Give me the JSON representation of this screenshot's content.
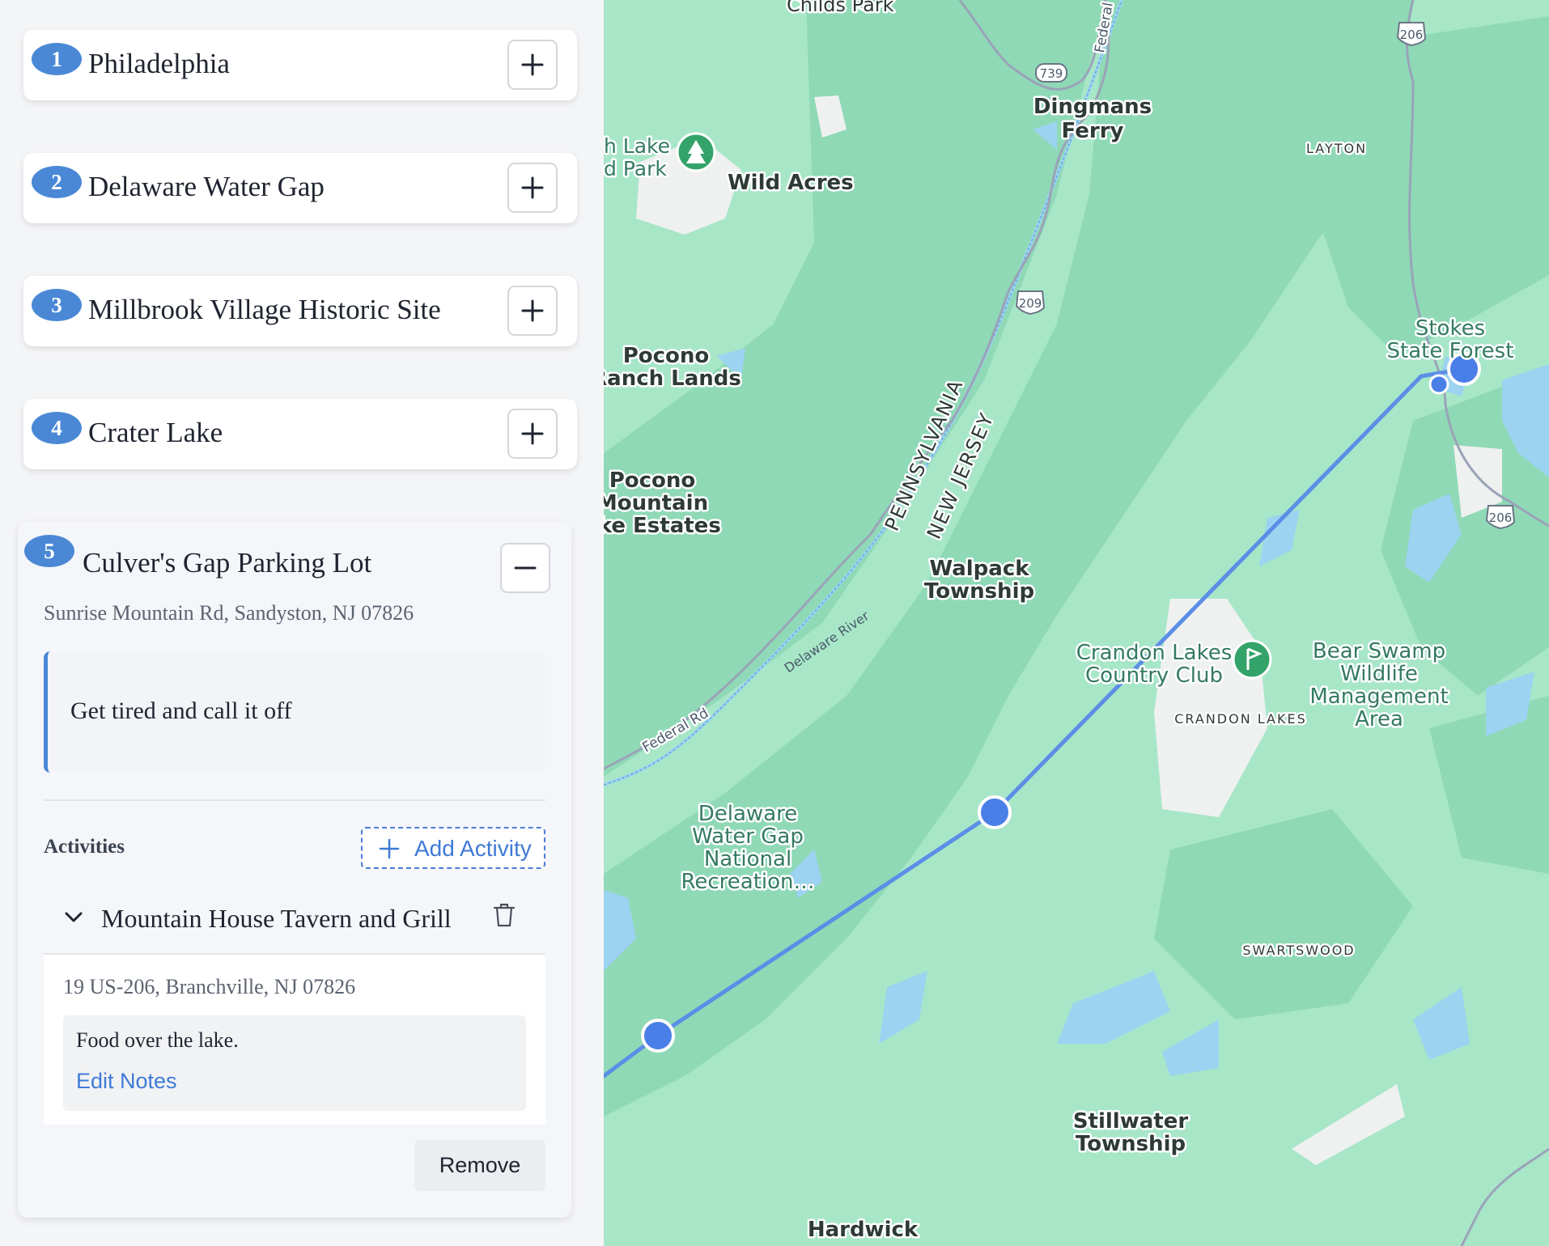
{
  "stops": [
    {
      "number": "1",
      "name": "Philadelphia"
    },
    {
      "number": "2",
      "name": "Delaware Water Gap"
    },
    {
      "number": "3",
      "name": "Millbrook Village Historic Site"
    },
    {
      "number": "4",
      "name": "Crater Lake"
    }
  ],
  "expanded_stop": {
    "number": "5",
    "name": "Culver's Gap Parking Lot",
    "address": "Sunrise Mountain Rd, Sandyston, NJ 07826",
    "note": "Get tired and call it off",
    "activities_label": "Activities",
    "add_activity_label": "Add Activity",
    "activity": {
      "name": "Mountain House Tavern and Grill",
      "address": "19 US-206, Branchville, NJ 07826",
      "notes": "Food over the lake.",
      "edit_notes_label": "Edit Notes"
    },
    "remove_label": "Remove"
  },
  "map": {
    "colors": {
      "land": "#a8e6c8",
      "forest": "#8fd9b6",
      "water": "#9cd3f0",
      "route": "#5b8ee6",
      "marker": "#4a7fe8",
      "road": "#9aa3b8",
      "urban": "#eef1ef"
    },
    "labels": {
      "childs_park": "Childs Park",
      "dingmans": [
        "Dingmans",
        "Ferry"
      ],
      "layton": "LAYTON",
      "lake_park": [
        "h Lake",
        "d Park"
      ],
      "wild_acres": "Wild Acres",
      "pocono_ranch": [
        "Pocono",
        "Ranch Lands"
      ],
      "pocono_mountain": [
        "Pocono",
        "Mountain",
        "ake Estates"
      ],
      "stokes": [
        "Stokes",
        "State Forest"
      ],
      "pennsylvania": "PENNSYLVANIA",
      "new_jersey": "NEW JERSEY",
      "walpack": [
        "Walpack",
        "Township"
      ],
      "delaware_river": "Delaware River",
      "federal_rd": "Federal Rd",
      "federal_rd_top": "Federal",
      "crandon_club": [
        "Crandon Lakes",
        "Country Club"
      ],
      "crandon_lakes": "CRANDON LAKES",
      "bear_swamp": [
        "Bear Swamp",
        "Wildlife",
        "Management",
        "Area"
      ],
      "dwg_nra": [
        "Delaware",
        "Water Gap",
        "National",
        "Recreation…"
      ],
      "swartswood": "SWARTSWOOD",
      "stillwater": [
        "Stillwater",
        "Township"
      ],
      "hardwick": "Hardwick"
    },
    "shields": {
      "us206_top": "206",
      "r739": "739",
      "us209": "209",
      "us206_right": "206"
    },
    "icons": [
      "tree-pin-icon",
      "golf-pin-icon",
      "route-marker"
    ]
  }
}
